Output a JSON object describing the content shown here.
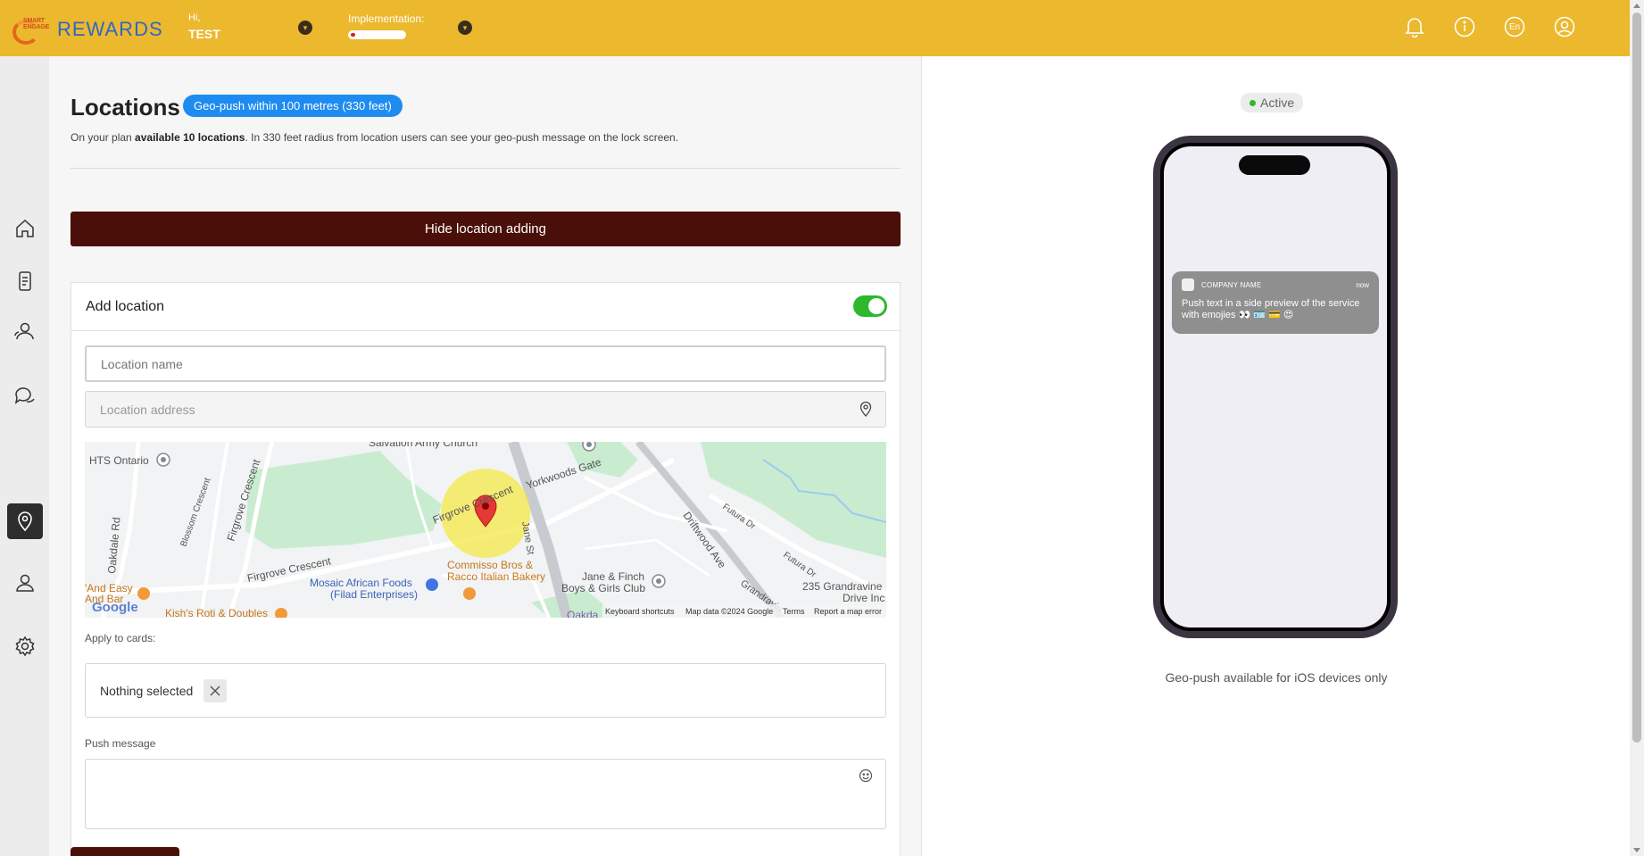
{
  "header": {
    "logo_tiny": "SMART ENGAGE",
    "logo_text": "REWARDS",
    "greeting": "Hi,",
    "user_name": "TEST",
    "implementation_label": "Implementation:",
    "implementation_progress": 0.08,
    "language": "En"
  },
  "colors": {
    "topbar": "#ebb82e",
    "accent_button": "#4a0f08",
    "badge_blue": "#1e8bf0",
    "toggle_on": "#2eb82e"
  },
  "sidebar": {
    "items": [
      {
        "name": "home",
        "icon": "home-icon"
      },
      {
        "name": "cards",
        "icon": "phone-card-icon"
      },
      {
        "name": "clients",
        "icon": "users-icon"
      },
      {
        "name": "messages",
        "icon": "chat-icon"
      },
      {
        "name": "locations",
        "icon": "location-pin-icon",
        "active": true
      },
      {
        "name": "managers",
        "icon": "user-icon"
      },
      {
        "name": "settings",
        "icon": "gear-icon"
      }
    ]
  },
  "main": {
    "title": "Locations",
    "geo_badge": "Geo-push within 100 metres (330 feet)",
    "plan_prefix": "On your plan ",
    "plan_bold": "available 10 locations",
    "plan_suffix": ". In 330 feet radius from location users can see your geo-push message on the lock screen.",
    "hide_button": "Hide location adding",
    "add_location": {
      "title": "Add location",
      "toggle_on": true,
      "name_placeholder": "Location name",
      "address_placeholder": "Location address",
      "apply_label": "Apply to cards:",
      "cards_value": "Nothing selected",
      "push_label": "Push message",
      "push_value": ""
    },
    "map": {
      "labels": {
        "hts": "HTS Ontario",
        "salvation": "Salvation Army Church",
        "yorkwoods": "Yorkwoods Gate",
        "blossom": "Blossom Crescent",
        "firgrove_cr": "Firgrove Crescent",
        "firgrove_bottom": "Firgrove Crescent",
        "firgrove_mid": "Firgrove Crescent",
        "oakdale": "Oakdale Rd",
        "driftwood": "Driftwood Ave",
        "futura1": "Futura Dr",
        "futura2": "Futura Dr",
        "jane": "Jane St",
        "mosaic1": "Mosaic African Foods",
        "mosaic2": "(Filad Enterprises)",
        "commisso1": "Commisso Bros &",
        "commisso2": "Racco Italian Bakery",
        "janefinch1": "Jane & Finch",
        "janefinch2": "Boys & Girls Club",
        "grandravine1": "235 Grandravine",
        "grandravine2": "Drive Inc",
        "easy1": "'And Easy",
        "easy2": "And Bar",
        "kish": "Kish's Roti & Doubles",
        "oakdale2": "Oakda",
        "grandravine_road": "Grandravin",
        "google": "Google",
        "shortcuts": "Keyboard shortcuts",
        "mapdata": "Map data ©2024 Google",
        "terms": "Terms",
        "report": "Report a map error"
      }
    }
  },
  "preview": {
    "status": "Active",
    "notif_app": "COMPANY NAME",
    "notif_time": "now",
    "notif_text": "Push text in a side preview of the service with emojies 👀 🪪 💳 😍",
    "note": "Geo-push available for iOS devices only"
  }
}
